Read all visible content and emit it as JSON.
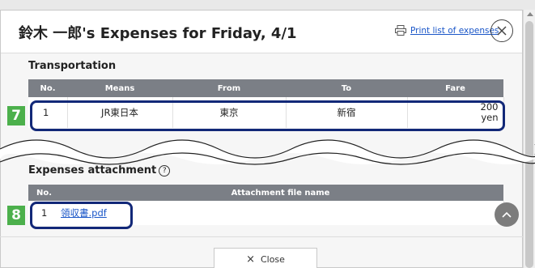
{
  "header": {
    "title": "鈴木 一郎's Expenses for Friday, 4/1",
    "print_label": "Print list of expenses"
  },
  "transportation": {
    "section_title": "Transportation",
    "columns": [
      "No.",
      "Means",
      "From",
      "To",
      "Fare"
    ],
    "rows": [
      {
        "no": "1",
        "means": "JR東日本",
        "from": "東京",
        "to": "新宿",
        "fare_amount": "200",
        "fare_unit": "yen"
      }
    ]
  },
  "attachments": {
    "section_title": "Expenses attachment",
    "help_symbol": "?",
    "columns": [
      "No.",
      "Attachment file name"
    ],
    "rows": [
      {
        "no": "1",
        "file": "領収書.pdf"
      }
    ]
  },
  "callouts": {
    "transport_row": "7",
    "attachment_row": "8"
  },
  "footer": {
    "close_label": "Close",
    "close_symbol": "×"
  },
  "colors": {
    "header_bg": "#7b7f86",
    "highlight_border": "#122878",
    "callout_badge": "#4cb04c",
    "link": "#1a56c8"
  },
  "icons": [
    "printer-icon",
    "close-circle-icon",
    "help-circle-icon",
    "chevron-up-icon"
  ]
}
